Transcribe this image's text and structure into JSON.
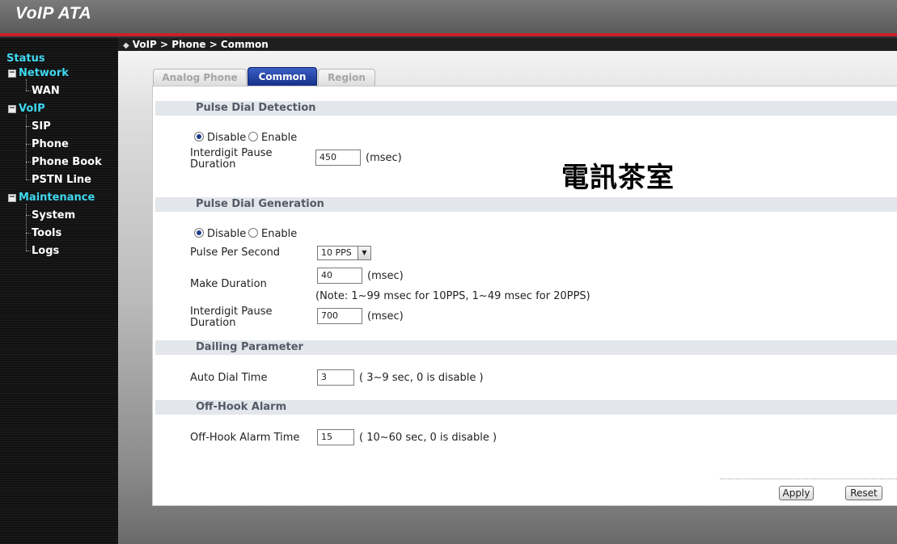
{
  "app": {
    "title": "VoIP ATA"
  },
  "breadcrumb": "VoIP > Phone > Common",
  "sidebar": {
    "status": "Status",
    "network": "Network",
    "wan": "WAN",
    "voip": "VoIP",
    "sip": "SIP",
    "phone": "Phone",
    "phone_book": "Phone Book",
    "pstn_line": "PSTN Line",
    "maintenance": "Maintenance",
    "system": "System",
    "tools": "Tools",
    "logs": "Logs"
  },
  "tabs": [
    {
      "label": "Analog Phone",
      "active": false
    },
    {
      "label": "Common",
      "active": true
    },
    {
      "label": "Region",
      "active": false
    }
  ],
  "watermark": "電訊茶室",
  "pulse_detection": {
    "title": "Pulse Dial Detection",
    "disable_label": "Disable",
    "enable_label": "Enable",
    "selected": "Disable",
    "interdigit_label_1": "Interdigit Pause",
    "interdigit_label_2": "Duration",
    "interdigit_value": "450",
    "interdigit_unit": "(msec)"
  },
  "pulse_generation": {
    "title": "Pulse Dial Generation",
    "disable_label": "Disable",
    "enable_label": "Enable",
    "selected": "Disable",
    "pps_label": "Pulse Per Second",
    "pps_value": "10 PPS",
    "make_label": "Make Duration",
    "make_value": "40",
    "make_unit": "(msec)",
    "note": "(Note: 1~99 msec for 10PPS, 1~49 msec for 20PPS)",
    "interdigit_label_1": "Interdigit Pause",
    "interdigit_label_2": "Duration",
    "interdigit_value": "700",
    "interdigit_unit": "(msec)"
  },
  "dialing": {
    "title": "Dailing Parameter",
    "auto_dial_label": "Auto Dial Time",
    "auto_dial_value": "3",
    "auto_dial_hint": "( 3~9 sec, 0 is disable )"
  },
  "offhook": {
    "title": "Off-Hook Alarm",
    "alarm_label": "Off-Hook Alarm Time",
    "alarm_value": "15",
    "alarm_hint": "( 10~60 sec, 0 is disable )"
  },
  "buttons": {
    "apply": "Apply",
    "reset": "Reset"
  },
  "colors": {
    "accent": "#cc1f2a",
    "nav_top": "#3fd8ef",
    "tab_active": "#1f3d9a"
  }
}
